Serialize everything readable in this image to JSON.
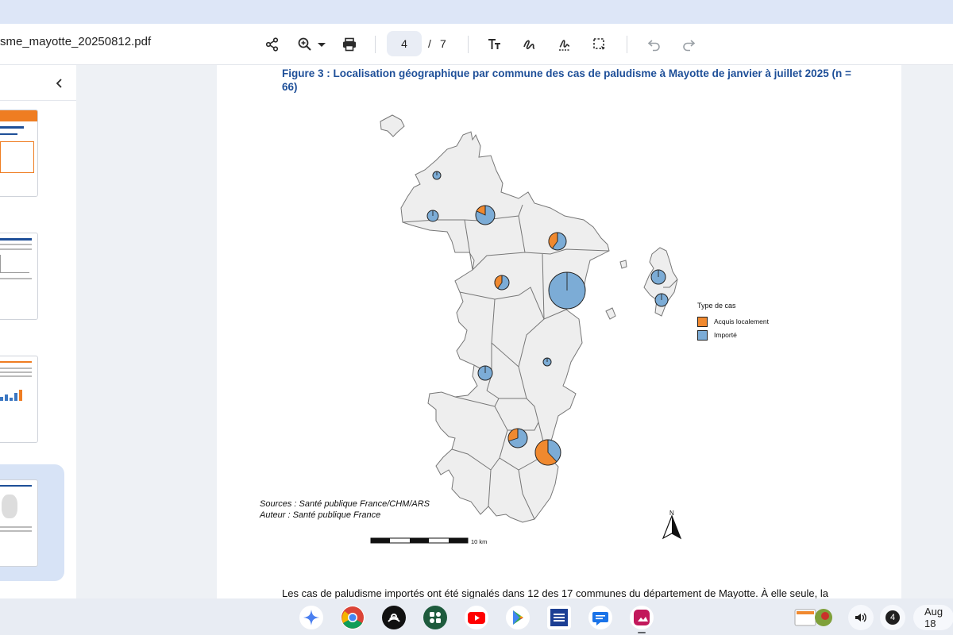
{
  "toolbar": {
    "filename": "sme_mayotte_20250812.pdf",
    "page_current": "4",
    "page_separator": "/",
    "page_total": "7",
    "icons": [
      "share-icon",
      "zoom-in-icon",
      "chevron-down-icon",
      "print-icon",
      "text-icon",
      "draw-icon",
      "signature-icon",
      "select-area-icon",
      "undo-icon",
      "redo-icon"
    ]
  },
  "sidebar": {
    "collapse_icon": "chevron-left-icon",
    "thumbnails": 4,
    "selected_index": 4
  },
  "document": {
    "figure_title": "Figure 3 : Localisation géographique par commune des cas de paludisme à Mayotte de janvier à juillet 2025 (n = 66)",
    "legend": {
      "title": "Type de cas",
      "items": [
        {
          "label": "Acquis localement",
          "color": "#f0892f"
        },
        {
          "label": "Importé",
          "color": "#7cacd6"
        }
      ]
    },
    "sources": "Sources : Santé publique France/CHM/ARS",
    "author": "Auteur : Santé publique France",
    "scale_label": "10 km",
    "north_label": "N",
    "body_text": "Les cas de paludisme importés ont été signalés dans 12 des 17 communes du département de Mayotte. À elle seule, la"
  },
  "shelf": {
    "apps": [
      "gemini-icon",
      "chrome-icon",
      "podcast-icon",
      "google-apps-icon",
      "youtube-icon",
      "play-store-icon",
      "weather-channel-icon",
      "messages-icon",
      "gallery-icon"
    ],
    "notification_count": "4",
    "date": "Aug 18"
  },
  "colors": {
    "local": "#f0892f",
    "imported": "#7cacd6",
    "title_blue": "#1e4f98",
    "land": "#eeeeee"
  }
}
